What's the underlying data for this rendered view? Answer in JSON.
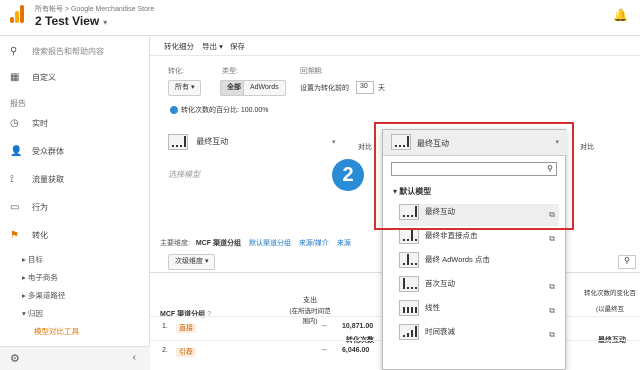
{
  "header": {
    "account": "所有帐号 > Google Merchandise Store",
    "view": "2 Test View",
    "dropdown": "▾",
    "bell": "🔔"
  },
  "sidebar": {
    "search": "搜索报告和帮助内容",
    "custom": "自定义",
    "reports_head": "报告",
    "items": [
      {
        "label": "实时",
        "icon": "◷"
      },
      {
        "label": "受众群体",
        "icon": "👤"
      },
      {
        "label": "流量获取",
        "icon": "⟟"
      },
      {
        "label": "行为",
        "icon": "▭"
      },
      {
        "label": "转化",
        "icon": "⚑"
      }
    ],
    "subs": [
      "目标",
      "电子商务",
      "多渠道路径",
      "归因",
      "模型对比工具"
    ]
  },
  "toolbar": {
    "items": [
      "转化细分",
      "导出 ▾",
      "保存"
    ]
  },
  "filters": {
    "conv_label": "转化:",
    "conv_value": "所有",
    "type_label": "类型:",
    "type_all": "全部",
    "type_adwords": "AdWords",
    "lookback_label": "回溯期:",
    "lookback_text": "设置为转化前的",
    "lookback_value": "30",
    "lookback_unit": "天",
    "conv_pct": "转化次数的百分比: 100.00%"
  },
  "model": {
    "left_label": "最终互动",
    "placeholder": "选择模型",
    "compare": "对比",
    "compare_right": "对比"
  },
  "step_badge": "2",
  "dims": {
    "main_label": "主要维度:",
    "current": "MCF 渠道分组",
    "links": [
      "默认渠道分组",
      "来源/媒介",
      "来源"
    ],
    "secondary": "次级维度 ▾"
  },
  "table": {
    "col_channel": "MCF 渠道分组",
    "col_spend": "支出",
    "col_spend_sub": "(在所选时间范围内)",
    "col_conversions": "转化次数",
    "col_right1": "转化次数的变化百",
    "col_right1_sub": "(以最终互",
    "col_right2": "最终互动",
    "rows": [
      {
        "idx": "1.",
        "channel": "直接",
        "spend": "--",
        "conversions": "10,871.00"
      },
      {
        "idx": "2.",
        "channel": "引荐",
        "spend": "--",
        "conversions": "6,046.00"
      }
    ]
  },
  "popup": {
    "current": "最终互动",
    "section": "默认模型",
    "items": [
      "最终互动",
      "最终非直接点击",
      "最终 AdWords 点击",
      "首次互动",
      "线性",
      "时间衰减"
    ]
  }
}
